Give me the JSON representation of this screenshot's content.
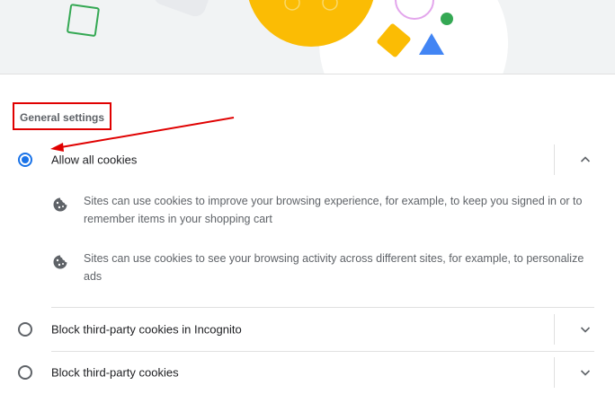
{
  "general_settings": {
    "title": "General settings"
  },
  "options": [
    {
      "label": "Allow all cookies",
      "selected": true,
      "expanded": true
    },
    {
      "label": "Block third-party cookies in Incognito",
      "selected": false,
      "expanded": false
    },
    {
      "label": "Block third-party cookies",
      "selected": false,
      "expanded": false
    }
  ],
  "details": [
    {
      "icon": "cookie-icon",
      "text": "Sites can use cookies to improve your browsing experience, for example, to keep you signed in or to remember items in your shopping cart"
    },
    {
      "icon": "cookie-icon",
      "text": "Sites can use cookies to see your browsing activity across different sites, for example, to personalize ads"
    }
  ],
  "colors": {
    "accent": "#1a73e8",
    "annotation": "#e00000",
    "banner_bg": "#f1f3f4"
  }
}
